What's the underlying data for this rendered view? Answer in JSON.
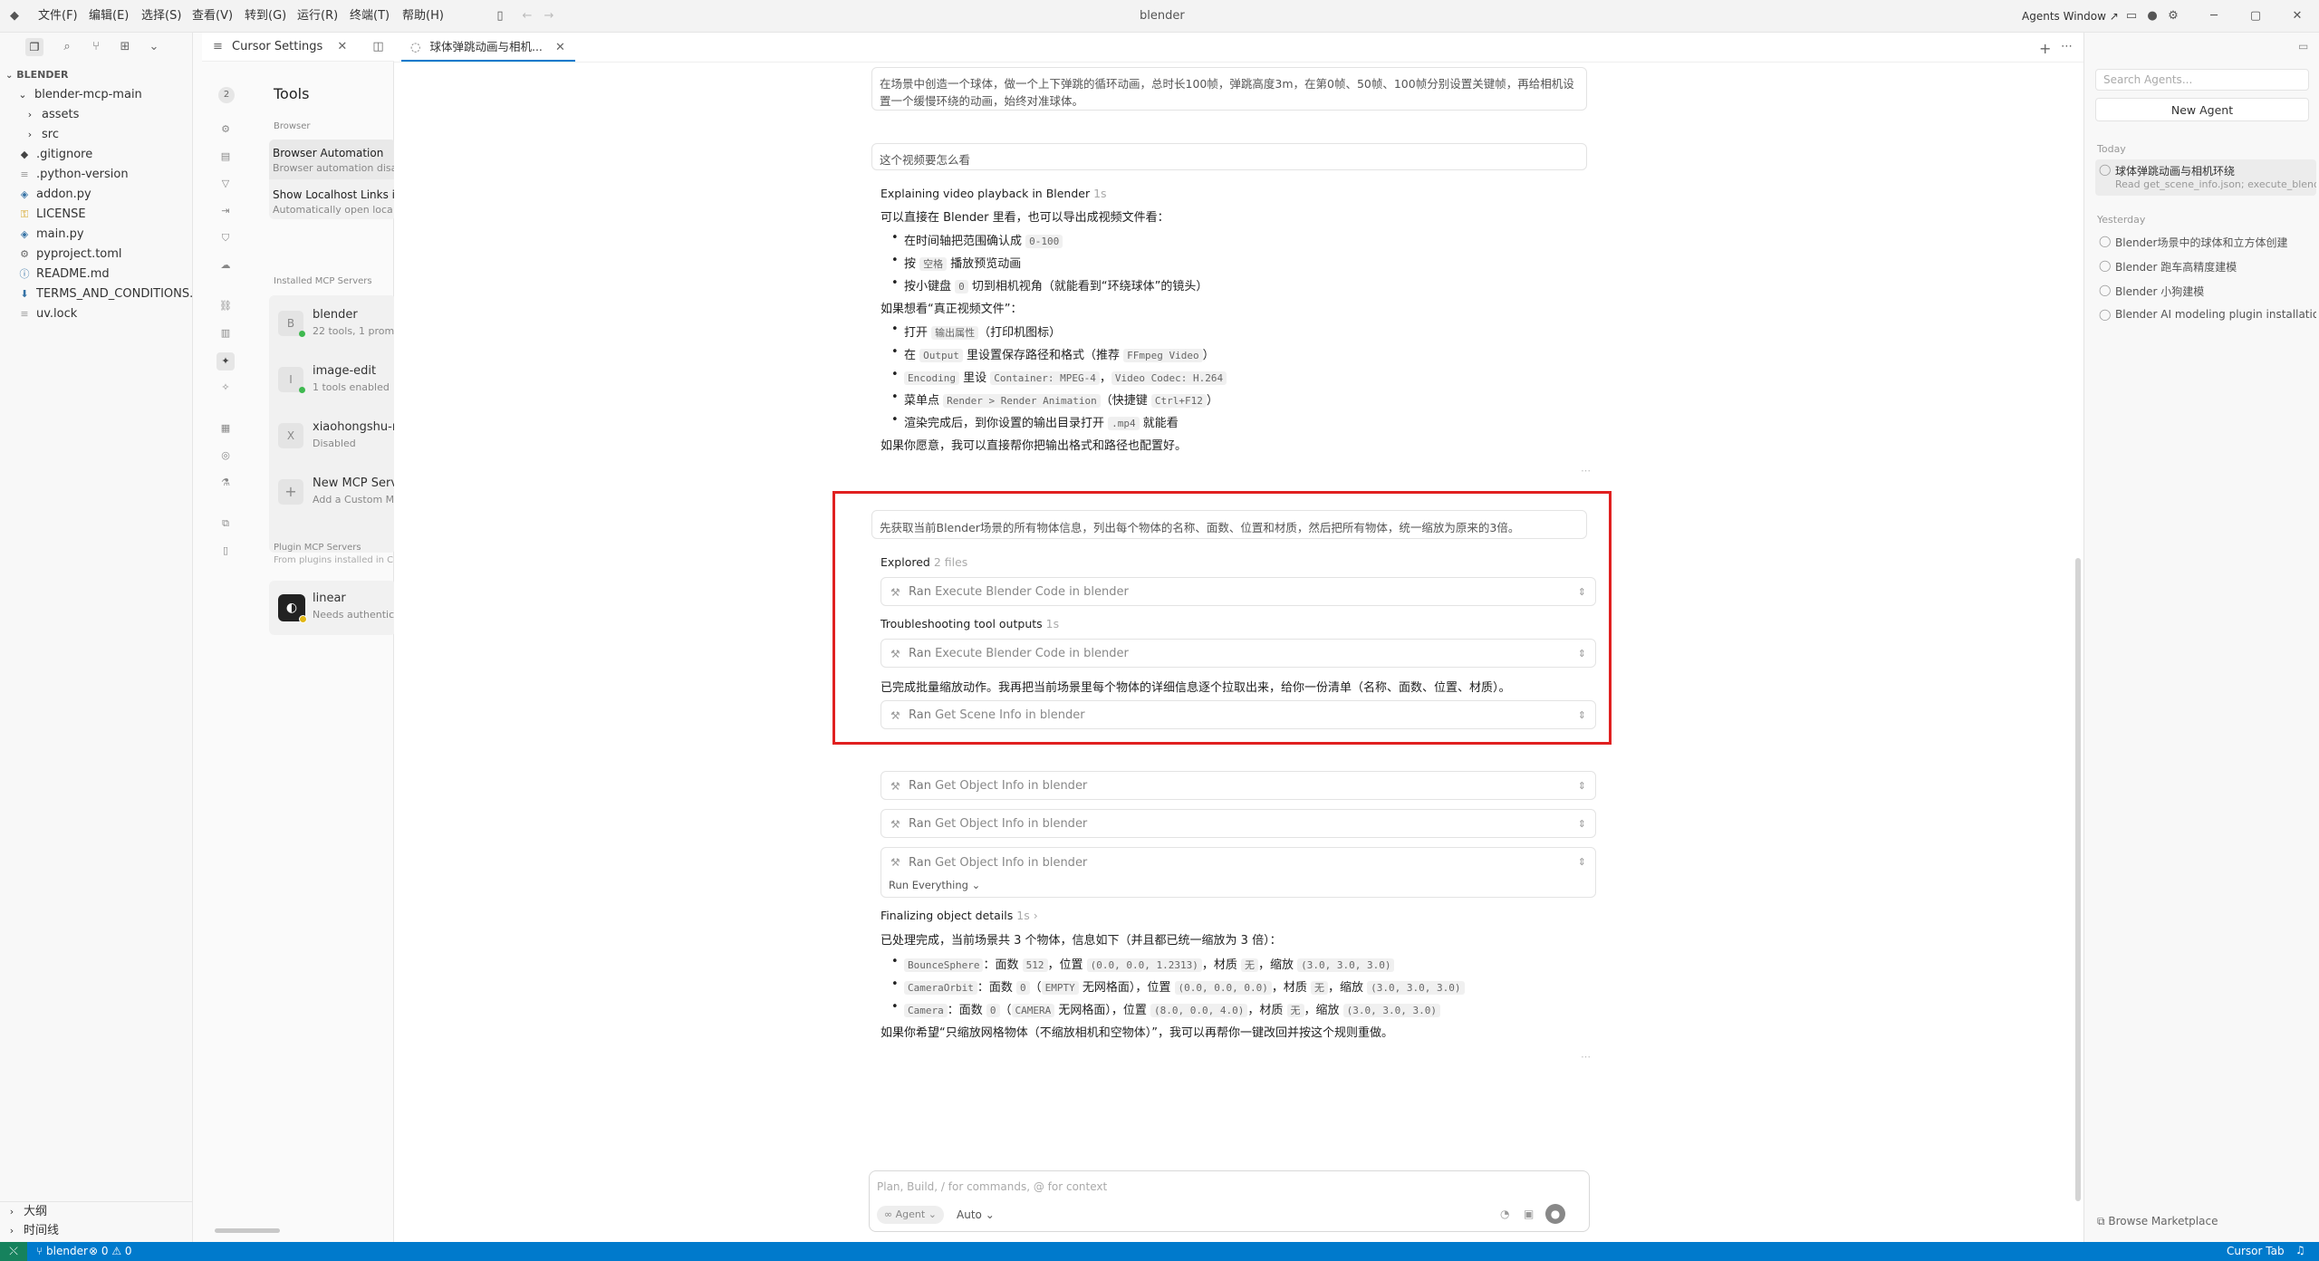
{
  "titlebar": {
    "menus": [
      "文件(F)",
      "编辑(E)",
      "选择(S)",
      "查看(V)",
      "转到(G)",
      "运行(R)",
      "终端(T)",
      "帮助(H)"
    ],
    "title": "blender",
    "agents_window": "Agents Window ↗"
  },
  "explorer": {
    "section": "BLENDER",
    "root": "blender-mcp-main",
    "items": [
      {
        "label": "assets",
        "icon": "chevron-right-icon"
      },
      {
        "label": "src",
        "icon": "chevron-right-icon"
      },
      {
        "label": ".gitignore",
        "icon": "git-icon"
      },
      {
        "label": ".python-version",
        "icon": "file-icon"
      },
      {
        "label": "addon.py",
        "icon": "python-icon"
      },
      {
        "label": "LICENSE",
        "icon": "license-icon"
      },
      {
        "label": "main.py",
        "icon": "python-icon"
      },
      {
        "label": "pyproject.toml",
        "icon": "gear-icon"
      },
      {
        "label": "README.md",
        "icon": "info-icon"
      },
      {
        "label": "TERMS_AND_CONDITIONS....",
        "icon": "markdown-icon"
      },
      {
        "label": "uv.lock",
        "icon": "file-icon"
      }
    ],
    "outline": "大纲",
    "timeline": "时间线"
  },
  "settings": {
    "tab_label": "Cursor Settings",
    "badge": "2",
    "heading": "Tools",
    "browser_label": "Browser",
    "browser_automation_title": "Browser Automation",
    "browser_automation_sub": "Browser automation disa",
    "localhost_title": "Show Localhost Links in",
    "localhost_sub": "Automatically open loca",
    "installed_label": "Installed MCP Servers",
    "servers": [
      {
        "badge": "B",
        "name": "blender",
        "sub": "22 tools, 1 prom",
        "status": "enabled"
      },
      {
        "badge": "I",
        "name": "image-edit",
        "sub": "1 tools enabled",
        "status": "enabled"
      },
      {
        "badge": "X",
        "name": "xiaohongshu-m",
        "sub": "Disabled",
        "status": "disabled"
      },
      {
        "badge": "+",
        "name": "New MCP Serv",
        "sub": "Add a Custom M",
        "status": "none"
      }
    ],
    "plugin_label": "Plugin MCP Servers",
    "plugin_sub": "From plugins installed in Cu",
    "plugin_server": {
      "name": "linear",
      "sub": "Needs authentic"
    }
  },
  "chat": {
    "tab_label": "球体弹跳动画与相机...",
    "first_prompt_line1": "在场景中创造一个球体，做一个上下弹跳的循环动画，总时长100帧，弹跳高度3m，在第0帧、50帧、100帧分别设置关键帧，再给相机设",
    "first_prompt_line2": "置一个缓慢环绕的动画，始终对准球体。",
    "second_prompt": "这个视频要怎么看",
    "thinking1": "Explaining video playback in Blender",
    "thinking1_time": "1s",
    "answer_intro": "可以直接在 Blender 里看，也可以导出成视频文件看：",
    "bullets_a": [
      {
        "pre": "在时间轴把范围确认成 ",
        "code": "0-100",
        "post": ""
      },
      {
        "pre": "按 ",
        "code": "空格",
        "post": " 播放预览动画"
      },
      {
        "pre": "按小键盘 ",
        "code": "0",
        "post": " 切到相机视角（就能看到“环绕球体”的镜头）"
      }
    ],
    "answer_mid": "如果想看“真正视频文件”：",
    "bullets_b": [
      {
        "pre": "打开 ",
        "code": "输出属性",
        "post": "（打印机图标）"
      },
      {
        "pre": "在 ",
        "code": "Output",
        "post": " 里设置保存路径和格式（推荐 ",
        "code2": "FFmpeg Video",
        "post2": "）"
      },
      {
        "pre": "",
        "code": "Encoding",
        "post": " 里设 ",
        "code2": "Container: MPEG-4",
        "post2": "，",
        "code3": "Video Codec: H.264",
        "post3": ""
      },
      {
        "pre": "菜单点 ",
        "code": "Render > Render Animation",
        "post": "（快捷键 ",
        "code2": "Ctrl+F12",
        "post2": "）"
      },
      {
        "pre": "渲染完成后，到你设置的输出目录打开 ",
        "code": ".mp4",
        "post": " 就能看"
      }
    ],
    "answer_end": "如果你愿意，我可以直接帮你把输出格式和路径也配置好。",
    "third_prompt": "先获取当前Blender场景的所有物体信息，列出每个物体的名称、面数、位置和材质，然后把所有物体，统一缩放为原来的3倍。",
    "explored": "Explored",
    "explored_count": "2 files",
    "tool_ran": "Ran",
    "tool_exec": "Execute Blender Code in blender",
    "troubleshooting": "Troubleshooting tool outputs",
    "troubleshooting_time": "1s",
    "scale_done": "已完成批量缩放动作。我再把当前场景里每个物体的详细信息逐个拉取出来，给你一份清单（名称、面数、位置、材质）。",
    "tool_scene": "Get Scene Info in blender",
    "tool_object": "Get Object Info in blender",
    "run_everything": "Run Everything",
    "finalizing": "Finalizing object details",
    "finalizing_time": "1s",
    "final_intro": "已处理完成，当前场景共 3 个物体，信息如下（并且都已统一缩放为 3 倍）：",
    "objects": [
      {
        "name": "BounceSphere",
        "t1": "：面数 ",
        "faces": "512",
        "t2": "，位置 ",
        "pos": "(0.0, 0.0, 1.2313)",
        "t3": "，材质 ",
        "mat": "无",
        "t4": "，缩放 ",
        "scale": "(3.0, 3.0, 3.0)"
      },
      {
        "name": "CameraOrbit",
        "t1": "：面数 ",
        "faces": "0",
        "t2": "（",
        "type": "EMPTY",
        "t2b": " 无网格面），位置 ",
        "pos": "(0.0, 0.0, 0.0)",
        "t3": "，材质 ",
        "mat": "无",
        "t4": "，缩放 ",
        "scale": "(3.0, 3.0, 3.0)"
      },
      {
        "name": "Camera",
        "t1": "：面数 ",
        "faces": "0",
        "t2": "（",
        "type": "CAMERA",
        "t2b": " 无网格面），位置 ",
        "pos": "(8.0, 0.0, 4.0)",
        "t3": "，材质 ",
        "mat": "无",
        "t4": "，缩放 ",
        "scale": "(3.0, 3.0, 3.0)"
      }
    ],
    "final_end": "如果你希望“只缩放网格物体（不缩放相机和空物体）”，我可以再帮你一键改回并按这个规则重做。",
    "composer_placeholder": "Plan, Build, / for commands, @ for context",
    "agent_chip": "∞ Agent",
    "auto_label": "Auto"
  },
  "agents": {
    "search_placeholder": "Search Agents...",
    "new_agent": "New Agent",
    "today": "Today",
    "today_item_title": "球体弹跳动画与相机环绕",
    "today_item_sub": "Read get_scene_info.json; execute_blende",
    "yesterday": "Yesterday",
    "yesterday_items": [
      "Blender场景中的球体和立方体创建",
      "Blender 跑车高精度建模",
      "Blender 小狗建模",
      "Blender AI modeling plugin installatio"
    ],
    "marketplace": "Browse Marketplace"
  },
  "statusbar": {
    "remote": "blender",
    "problems": "⊗ 0 ⚠ 0",
    "cursor_tab": "Cursor Tab"
  },
  "colors": {
    "statusbar": "#007acc",
    "highlight_box": "#e02020",
    "green_dot": "#3fb950"
  }
}
